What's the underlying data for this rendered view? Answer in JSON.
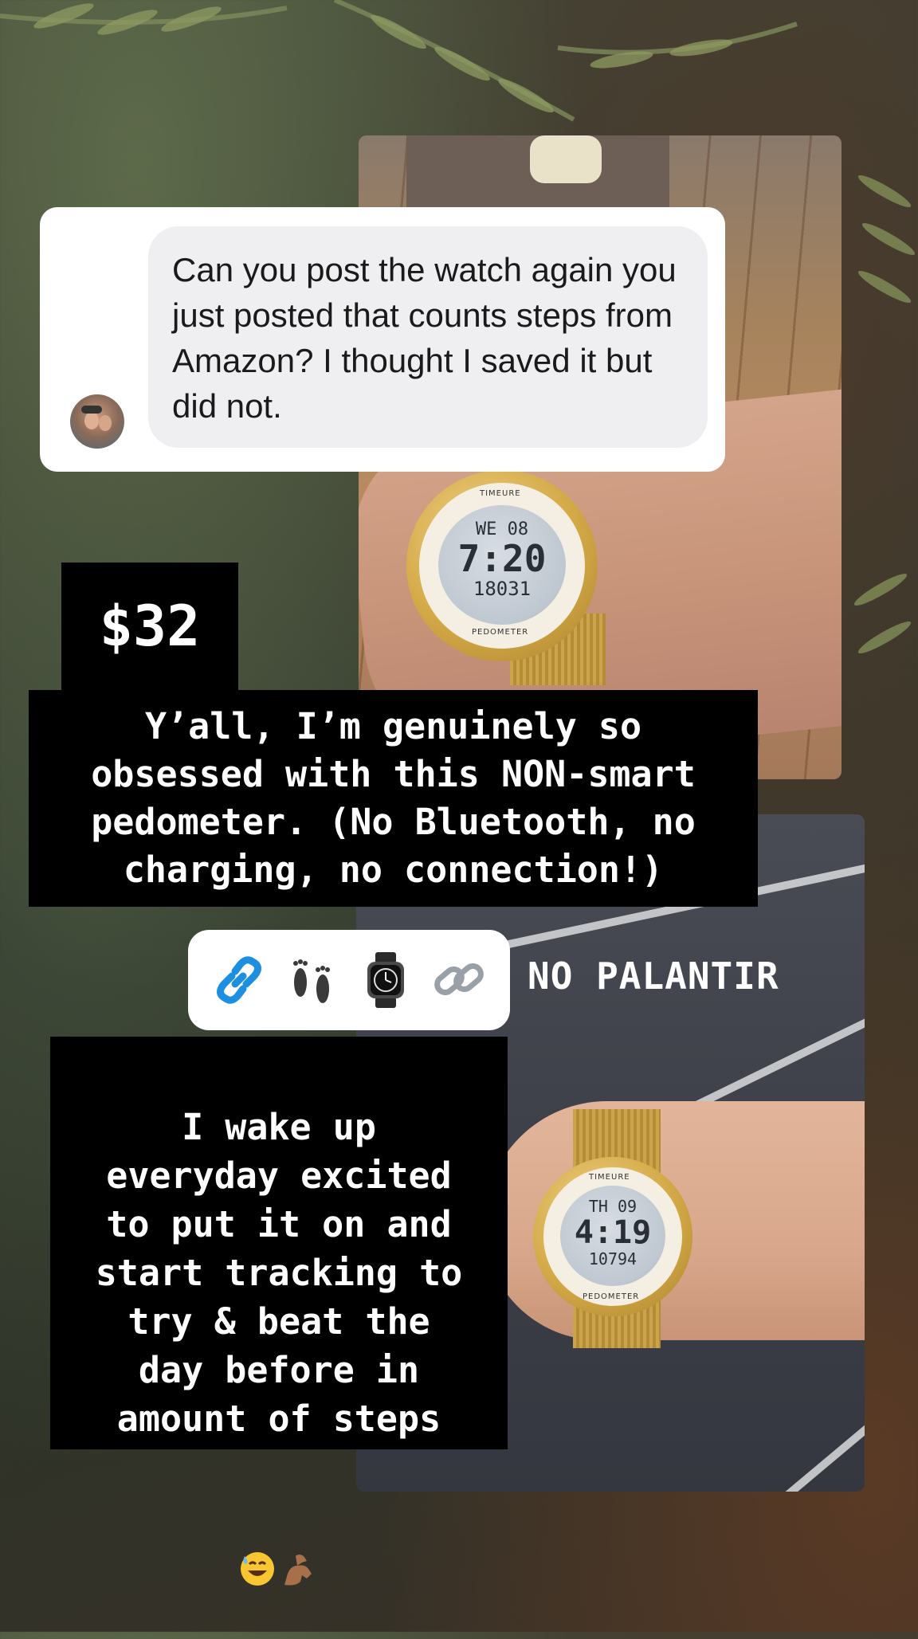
{
  "dm": {
    "message": "Can you post the watch again you just posted that counts steps from Amazon? I thought I saved it but did not."
  },
  "price": "$32",
  "caption_obsessed": "Y’all, I’m genuinely so\nobsessed with this NON-smart\npedometer. (No Bluetooth, no\ncharging, no connection!)",
  "emoji_pill": {
    "icons": [
      "link-icon",
      "footprints-icon",
      "watch-icon",
      "chain-icon"
    ]
  },
  "sticker_text": "NO PALANTIR",
  "caption_wake": "I wake up\neveryday excited\nto put it on and\nstart tracking to\ntry & beat the\nday before in\namount of steps",
  "caption_wake_emojis": [
    "sweat-smile-icon",
    "flexed-biceps-icon"
  ],
  "watch_top": {
    "brand": "TIMEURE",
    "day": "WE 08",
    "time": "7:20",
    "steps": "18031",
    "label": "PEDOMETER"
  },
  "watch_bottom": {
    "brand": "TIMEURE",
    "day": "TH 09",
    "time": "4:19",
    "steps": "10794",
    "label": "PEDOMETER"
  },
  "colors": {
    "caption_bg": "#000000",
    "caption_text": "#ffffff",
    "bubble_bg": "#efeff1",
    "link_blue": "#1d8fe0"
  }
}
